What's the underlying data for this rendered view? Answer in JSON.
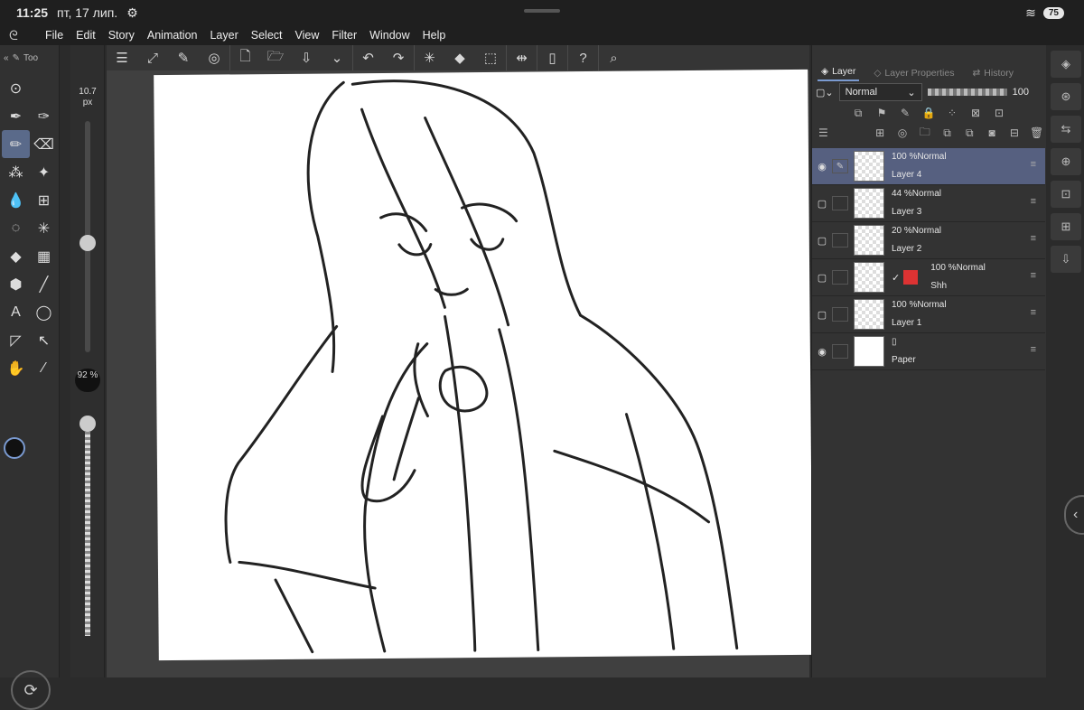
{
  "status": {
    "time": "11:25",
    "date": "пт, 17 лип.",
    "battery": "75"
  },
  "menu": [
    "File",
    "Edit",
    "Story",
    "Animation",
    "Layer",
    "Select",
    "View",
    "Filter",
    "Window",
    "Help"
  ],
  "tool_panel": {
    "tab_label": "Too"
  },
  "brush": {
    "size": "10.7 px",
    "opacity": "92 %"
  },
  "layer_panel": {
    "tabs": [
      "Layer",
      "Layer Properties",
      "History"
    ],
    "blend_mode": "Normal",
    "opacity_value": "100"
  },
  "layers": [
    {
      "mode": "100 %Normal",
      "name": "Layer 4",
      "selected": true,
      "visible": true
    },
    {
      "mode": "44 %Normal",
      "name": "Layer 3",
      "selected": false,
      "visible": false
    },
    {
      "mode": "20 %Normal",
      "name": "Layer 2",
      "selected": false,
      "visible": false
    },
    {
      "mode": "100 %Normal",
      "name": "Shh",
      "selected": false,
      "visible": false
    },
    {
      "mode": "100 %Normal",
      "name": "Layer 1",
      "selected": false,
      "visible": false
    },
    {
      "mode": "",
      "name": "Paper",
      "selected": false,
      "visible": true
    }
  ],
  "colors": {
    "accent": "#566080",
    "background": "#2b2b2b"
  }
}
